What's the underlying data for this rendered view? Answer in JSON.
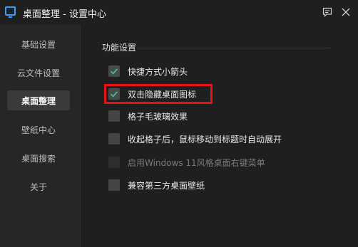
{
  "window": {
    "title": "桌面整理 - 设置中心"
  },
  "sidebar": {
    "items": [
      {
        "label": "基础设置"
      },
      {
        "label": "云文件设置"
      },
      {
        "label": "桌面整理"
      },
      {
        "label": "壁纸中心"
      },
      {
        "label": "桌面搜索"
      },
      {
        "label": "关于"
      }
    ],
    "active_index": 2
  },
  "main": {
    "section_title": "功能设置",
    "options": [
      {
        "label": "快捷方式小箭头",
        "checked": true,
        "enabled": true
      },
      {
        "label": "双击隐藏桌面图标",
        "checked": true,
        "enabled": true,
        "highlighted": true
      },
      {
        "label": "格子毛玻璃效果",
        "checked": false,
        "enabled": true
      },
      {
        "label": "收起格子后，鼠标移动到标题时自动展开",
        "checked": false,
        "enabled": true
      },
      {
        "label": "启用Windows 11风格桌面右键菜单",
        "checked": false,
        "enabled": false
      },
      {
        "label": "兼容第三方桌面壁纸",
        "checked": false,
        "enabled": true
      }
    ]
  },
  "colors": {
    "accent": "#3aa0ff",
    "highlight_border": "#e81313",
    "check": "#2bc6a0"
  }
}
